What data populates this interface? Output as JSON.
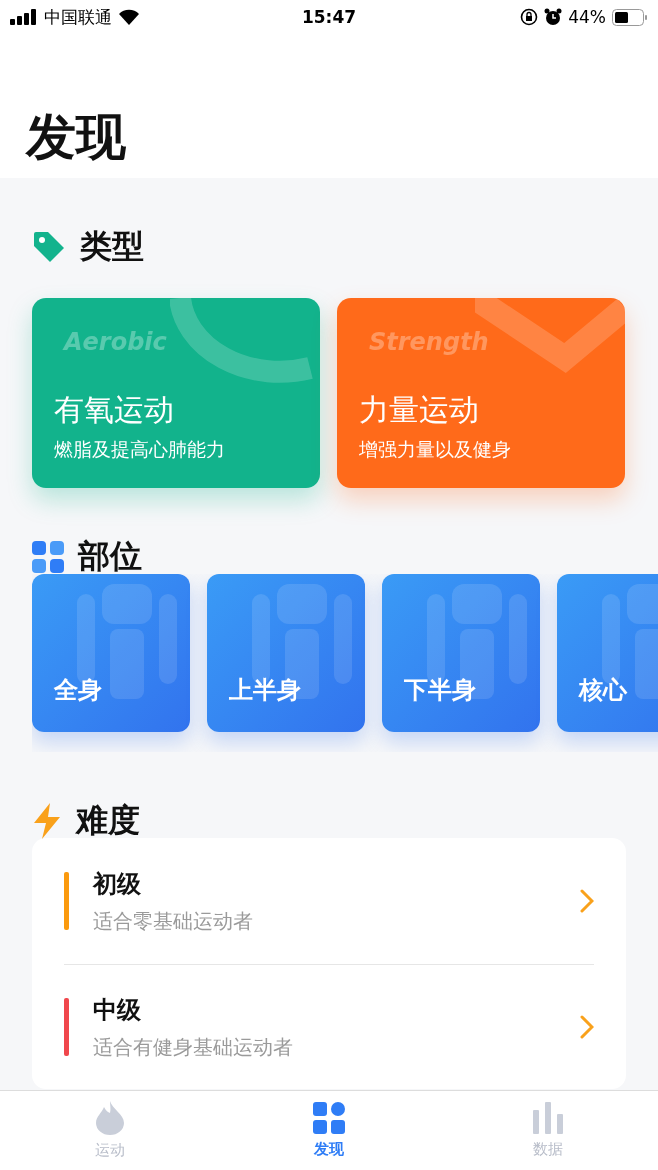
{
  "status_bar": {
    "carrier": "中国联通",
    "time": "15:47",
    "battery": "44%"
  },
  "title": "发现",
  "sections": [
    {
      "kind": "types",
      "title": "类型",
      "items": [
        {
          "watermark": "Aerobic",
          "title": "有氧运动",
          "subtitle": "燃脂及提高心肺能力",
          "color": "#12b38c"
        },
        {
          "watermark": "Strength",
          "title": "力量运动",
          "subtitle": "增强力量以及健身",
          "color": "#ff6a1a"
        }
      ]
    },
    {
      "kind": "parts",
      "title": "部位",
      "items": [
        {
          "label": "全身"
        },
        {
          "label": "上半身"
        },
        {
          "label": "下半身"
        },
        {
          "label": "核心"
        }
      ]
    },
    {
      "kind": "levels",
      "title": "难度",
      "items": [
        {
          "title": "初级",
          "subtitle": "适合零基础运动者",
          "color": "#fb9a0e"
        },
        {
          "title": "中级",
          "subtitle": "适合有健身基础运动者",
          "color": "#f0474c"
        }
      ]
    }
  ],
  "tabs": [
    {
      "label": "运动",
      "selected": false
    },
    {
      "label": "发现",
      "selected": true
    },
    {
      "label": "数据",
      "selected": false
    }
  ]
}
